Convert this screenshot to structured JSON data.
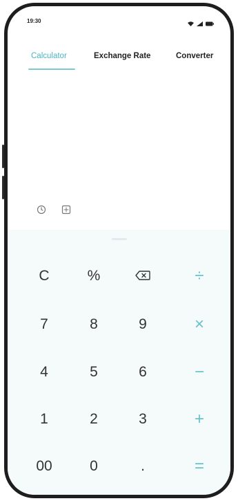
{
  "status_bar": {
    "time": "19:30",
    "icons": [
      "wifi-icon",
      "cellular-signal-icon",
      "battery-icon"
    ]
  },
  "tabs": [
    {
      "label": "Calculator",
      "active": true
    },
    {
      "label": "Exchange Rate",
      "active": false
    },
    {
      "label": "Converter",
      "active": false
    }
  ],
  "tools": [
    "history-icon",
    "scientific-mode-icon"
  ],
  "keypad": {
    "rows": [
      [
        "C",
        "%",
        "backspace-icon",
        "÷"
      ],
      [
        "7",
        "8",
        "9",
        "×"
      ],
      [
        "4",
        "5",
        "6",
        "−"
      ],
      [
        "1",
        "2",
        "3",
        "+"
      ],
      [
        "00",
        "0",
        ".",
        "="
      ]
    ]
  },
  "colors": {
    "accent": "#4cb5bf",
    "operator": "#66c3cc",
    "keypad_bg": "#f5fafb",
    "frame": "#1e1e1e"
  }
}
